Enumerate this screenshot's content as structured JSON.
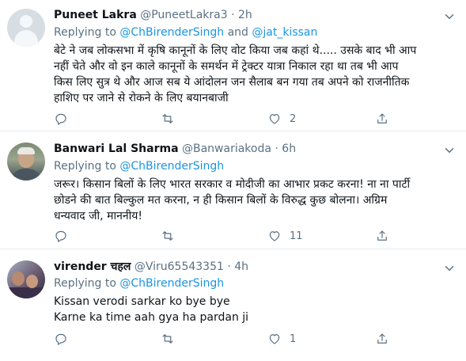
{
  "tweets": [
    {
      "name": "Puneet Lakra",
      "handle": "@PuneetLakra3",
      "dot": "·",
      "time": "2h",
      "replying_prefix": "Replying to",
      "mentions": [
        "@ChBirenderSingh",
        "@jat_kissan"
      ],
      "mention_joiner": "and",
      "text": "बेटे ने जब लोकसभा में कृषि कानूनों के लिए वोट किया जब कहां थे..... उसके बाद भी आप\nनहीं चेते और वो इन काले कानूनों के समर्थन में ट्रेक्टर यात्रा निकाल रहा था तब भी आप\nकिस लिए सुत्र थे और आज सब ये आंदोलन जन सैलाब बन गया तब अपने को राजनीतिक\nहाशिए पर जाने से रोकने के लिए बयानबाजी",
      "likes": "2"
    },
    {
      "name": "Banwari Lal Sharma",
      "handle": "@Banwariakoda",
      "dot": "·",
      "time": "6h",
      "replying_prefix": "Replying to",
      "mentions": [
        "@ChBirenderSingh"
      ],
      "text": "जरूर। किसान बिलों के लिए भारत सरकार व मोदीजी का आभार प्रकट करना! ना ना पार्टी\nछोडने की बात बिल्कुल मत करना, न ही किसान बिलों के विरुद्ध कुछ बोलना। अग्रिम\nधन्यवाद जी, माननीय!",
      "likes": "11"
    },
    {
      "name": "virender चहल",
      "handle": "@Viru65543351",
      "dot": "·",
      "time": "4h",
      "replying_prefix": "Replying to",
      "mentions": [
        "@ChBirenderSingh"
      ],
      "text": "Kissan verodi sarkar ko bye bye\nKarne ka time aah gya ha pardan ji",
      "likes": "1"
    }
  ],
  "icons": {
    "reply": "reply-icon",
    "retweet": "retweet-icon",
    "like": "heart-icon",
    "share": "share-icon",
    "more": "chevron-down-icon"
  },
  "colors": {
    "name": "#0f1419",
    "secondary": "#5b7083",
    "mention": "#1b95e0",
    "divider": "#e6ecf0"
  }
}
